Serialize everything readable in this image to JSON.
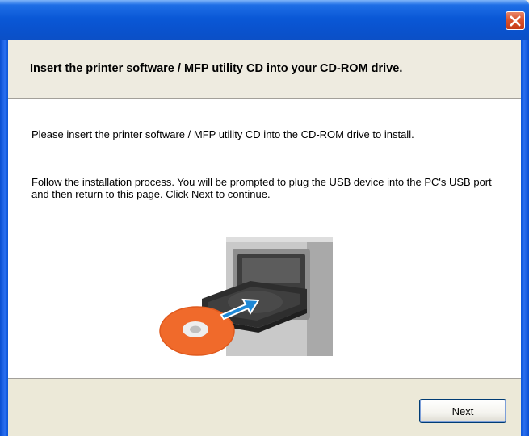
{
  "window": {
    "close_icon": "close-icon",
    "accent_color": "#0a58d6",
    "close_color": "#d9532e"
  },
  "header": {
    "title": "Insert the printer software / MFP utility CD into your CD-ROM drive."
  },
  "content": {
    "paragraph1": "Please insert the printer software / MFP utility CD into the CD-ROM drive to install.",
    "paragraph2": "Follow the installation process. You will be prompted to plug the USB device into the PC's USB port and then return to this page. Click Next to continue.",
    "illustration_icon": "cd-insert-illustration",
    "cd_color": "#f06a2b",
    "arrow_color": "#1e88d6"
  },
  "footer": {
    "next_label": "Next"
  }
}
